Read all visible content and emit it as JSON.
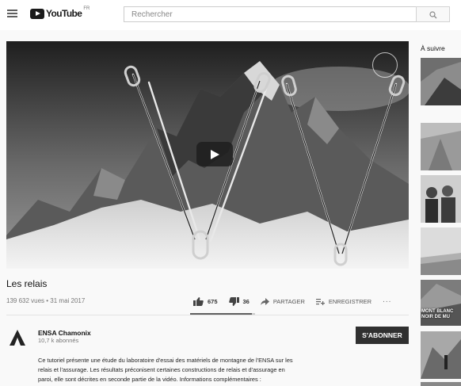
{
  "masthead": {
    "logo_text": "YouTube",
    "country_code": "FR",
    "search_placeholder": "Rechercher"
  },
  "video": {
    "title": "Les relais",
    "meta": "139 632 vues • 31 mai 2017",
    "likes": "675",
    "dislikes": "36",
    "share_label": "PARTAGER",
    "save_label": "ENREGISTRER",
    "more_label": "...",
    "like_ratio": 0.949
  },
  "channel": {
    "name": "ENSA Chamonix",
    "subscribers": "10,7 k abonnés",
    "subscribe_label": "S'ABONNER"
  },
  "description": {
    "line1": "Ce tutoriel présente une étude du laboratoire d'essai des matériels de montagne de l'ENSA sur les",
    "line2": "relais et l'assurage. Les résultats préconisent certaines constructions de relais et d'assurage en",
    "line3": "paroi,  elle sont décrites en seconde partie de la vidéo. Informations complémentaires :"
  },
  "sidebar": {
    "heading": "À suivre",
    "thumb_text_1": "MONT BLANC",
    "thumb_text_2": "NOIR DE MU"
  },
  "icons": {
    "menu": "menu-icon",
    "search": "search-icon",
    "like": "thumbs-up-icon",
    "dislike": "thumbs-down-icon",
    "share": "share-arrow-icon",
    "save": "playlist-add-icon",
    "play": "play-icon"
  }
}
